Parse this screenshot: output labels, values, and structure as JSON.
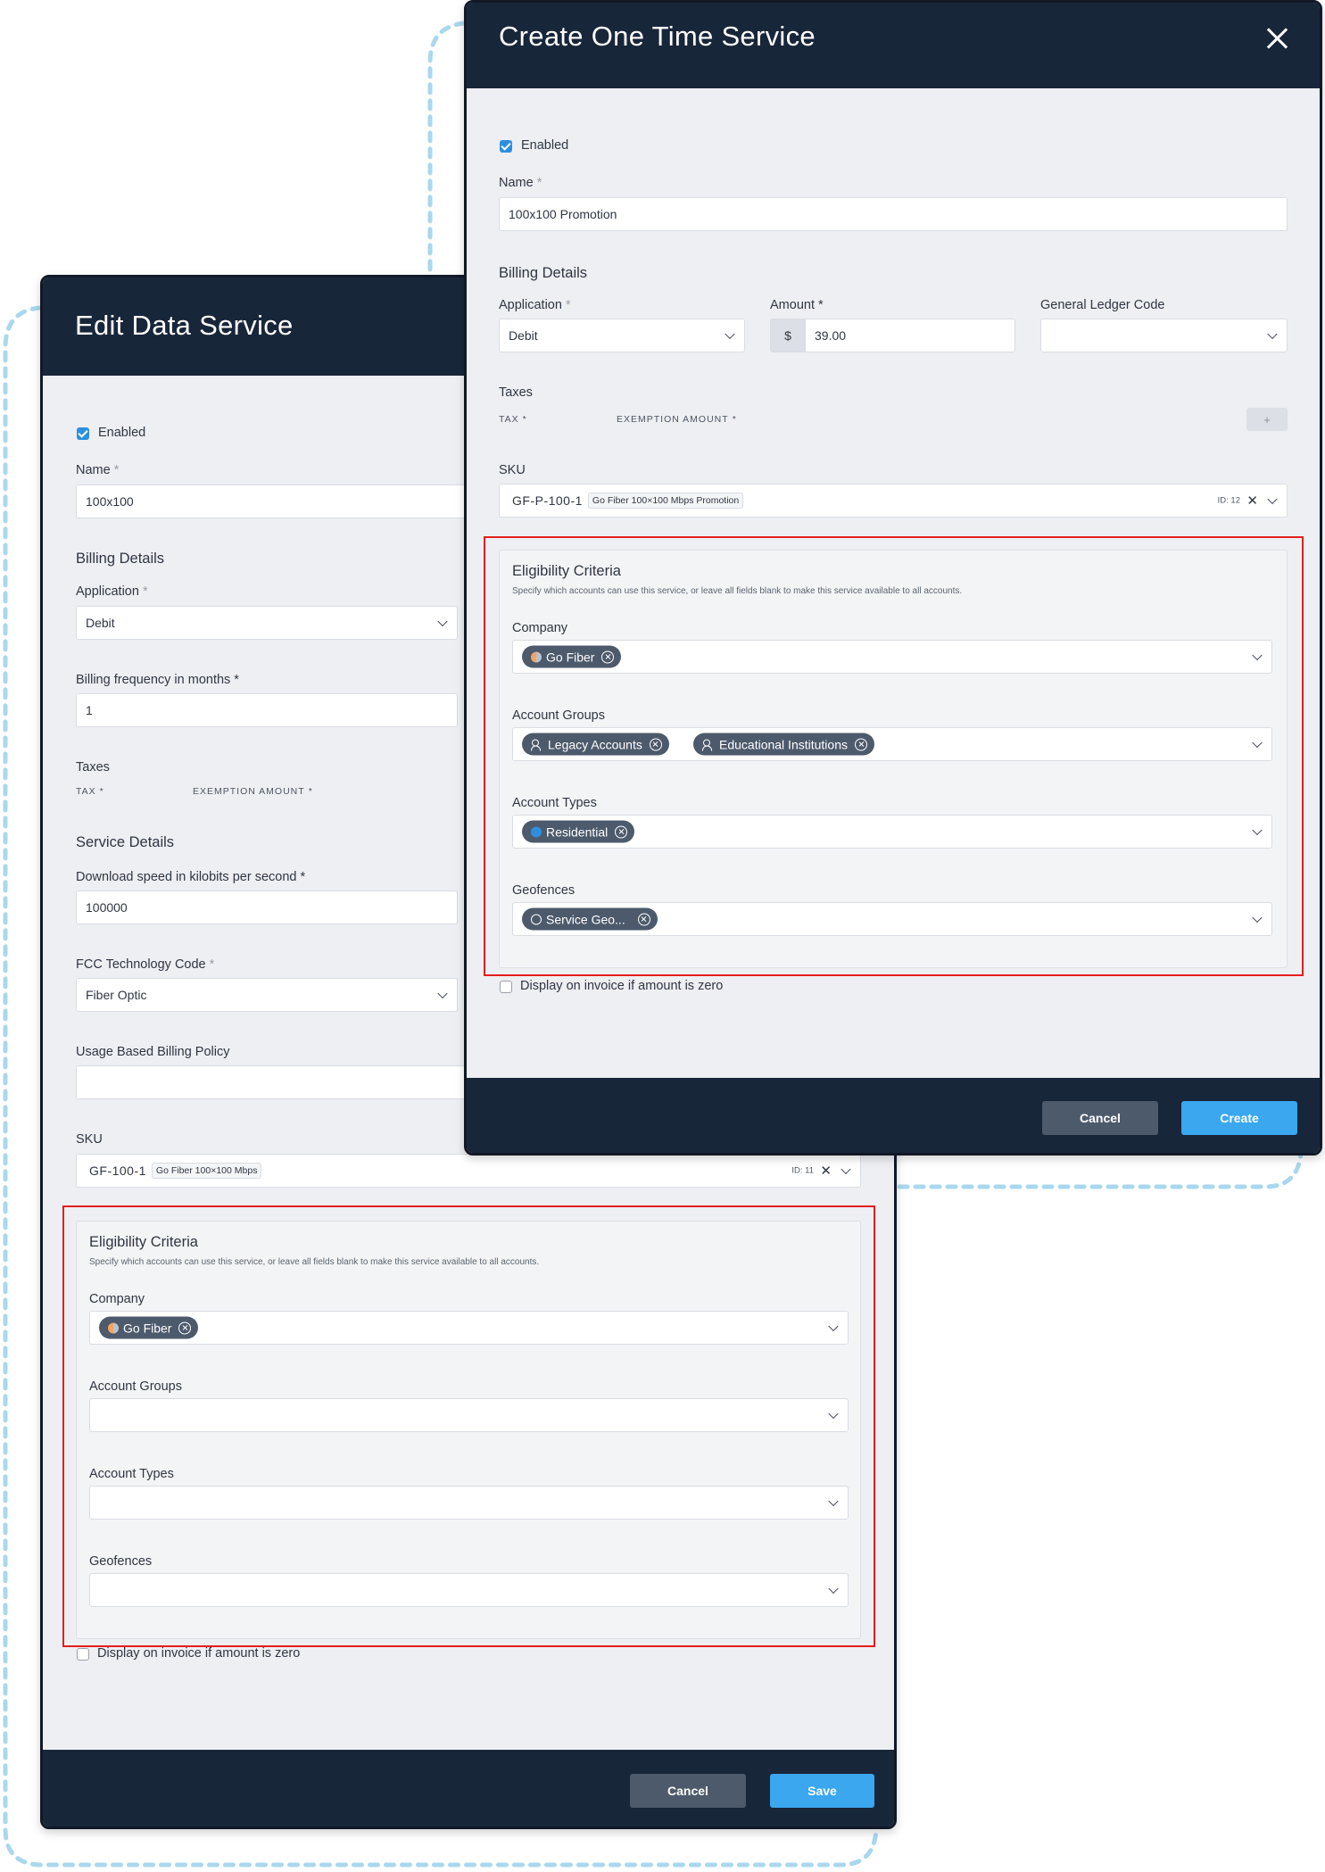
{
  "edit": {
    "title": "Edit Data Service",
    "enabled_label": "Enabled",
    "name_label": "Name",
    "name_value": "100x100",
    "billing_details": "Billing Details",
    "application_label": "Application",
    "application_value": "Debit",
    "billing_freq_label": "Billing frequency in months",
    "billing_freq_value": "1",
    "taxes": "Taxes",
    "tax_col": "TAX",
    "exemption_col": "EXEMPTION AMOUNT",
    "service_details": "Service Details",
    "download_label": "Download speed in kilobits per second",
    "download_value": "100000",
    "fcc_label": "FCC Technology Code",
    "fcc_value": "Fiber Optic",
    "usage_label": "Usage Based Billing Policy",
    "usage_value": "",
    "sku_label": "SKU",
    "sku_code": "GF-100-1",
    "sku_desc": "Go Fiber 100×100 Mbps",
    "sku_id": "ID: 11",
    "elig_title": "Eligibility Criteria",
    "elig_desc": "Specify which accounts can use this service, or leave all fields blank to make this service available to all accounts.",
    "company_label": "Company",
    "company_chip": "Go Fiber",
    "groups_label": "Account Groups",
    "types_label": "Account Types",
    "geofences_label": "Geofences",
    "display_zero": "Display on invoice if amount is zero",
    "cancel": "Cancel",
    "save": "Save"
  },
  "create": {
    "title": "Create One Time Service",
    "enabled_label": "Enabled",
    "name_label": "Name",
    "name_value": "100x100 Promotion",
    "billing_details": "Billing Details",
    "application_label": "Application",
    "application_value": "Debit",
    "amount_label": "Amount",
    "currency": "$",
    "amount_value": "39.00",
    "gl_label": "General Ledger Code",
    "gl_value": "",
    "taxes": "Taxes",
    "tax_col": "TAX",
    "exemption_col": "EXEMPTION AMOUNT",
    "add_tax": "+",
    "sku_label": "SKU",
    "sku_code": "GF-P-100-1",
    "sku_desc": "Go Fiber 100×100 Mbps Promotion",
    "sku_id": "ID: 12",
    "elig_title": "Eligibility Criteria",
    "elig_desc": "Specify which accounts can use this service, or leave all fields blank to make this service available to all accounts.",
    "company_label": "Company",
    "company_chip": "Go Fiber",
    "groups_label": "Account Groups",
    "group_chip_1": "Legacy Accounts",
    "group_chip_2": "Educational Institutions",
    "types_label": "Account Types",
    "type_chip": "Residential",
    "geofences_label": "Geofences",
    "geofence_chip": "Service Geo...",
    "display_zero": "Display on invoice if amount is zero",
    "cancel": "Cancel",
    "create": "Create"
  },
  "required_mark": "*",
  "colors": {
    "header": "#18263a",
    "accent": "#3aa7ef",
    "chip": "#4c5a6c",
    "highlight": "#e41e1e",
    "dashed": "#a9d8ee"
  }
}
